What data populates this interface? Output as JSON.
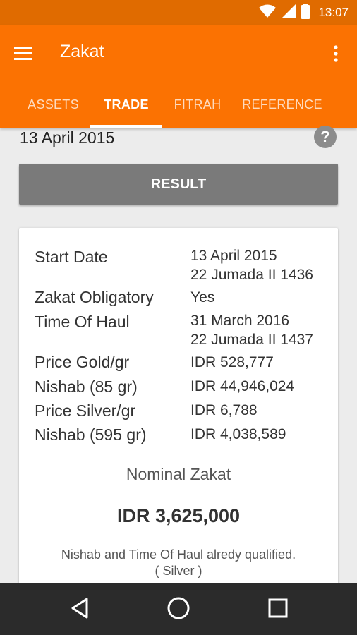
{
  "status_bar": {
    "time": "13:07"
  },
  "app_bar": {
    "title": "Zakat"
  },
  "tabs": [
    {
      "label": "ASSETS"
    },
    {
      "label": "TRADE"
    },
    {
      "label": "FITRAH"
    },
    {
      "label": "REFERENCE"
    }
  ],
  "date_field": {
    "value": "13 April  2015",
    "help_symbol": "?"
  },
  "result_button": {
    "label": "RESULT"
  },
  "result": {
    "rows": [
      {
        "label": "Start Date",
        "value": "13 April  2015",
        "value2": "22 Jumada II 1436"
      },
      {
        "label": "Zakat Obligatory",
        "value": "Yes"
      },
      {
        "label": "Time Of Haul",
        "value": "31 March 2016",
        "value2": "22 Jumada II 1437"
      },
      {
        "label": "Price Gold/gr",
        "value": "IDR 528,777"
      },
      {
        "label": "Nishab (85 gr)",
        "value": "IDR 44,946,024"
      },
      {
        "label": "Price Silver/gr",
        "value": "IDR 6,788"
      },
      {
        "label": "Nishab (595 gr)",
        "value": "IDR 4,038,589"
      }
    ],
    "nominal_title": "Nominal Zakat",
    "nominal_value": "IDR 3,625,000",
    "note_line1": "Nishab and Time Of Haul alredy qualified.",
    "note_line2": "( Silver )"
  },
  "icons": {
    "menu": "hamburger-menu-icon",
    "more": "more-vert-icon",
    "back": "back-triangle-icon",
    "home": "home-circle-icon",
    "recents": "recents-square-icon",
    "wifi": "wifi-icon",
    "signal": "signal-icon",
    "battery": "battery-icon"
  },
  "colors": {
    "primary": "#fb7202",
    "status": "#e06b00",
    "button": "#7a7a7a"
  }
}
